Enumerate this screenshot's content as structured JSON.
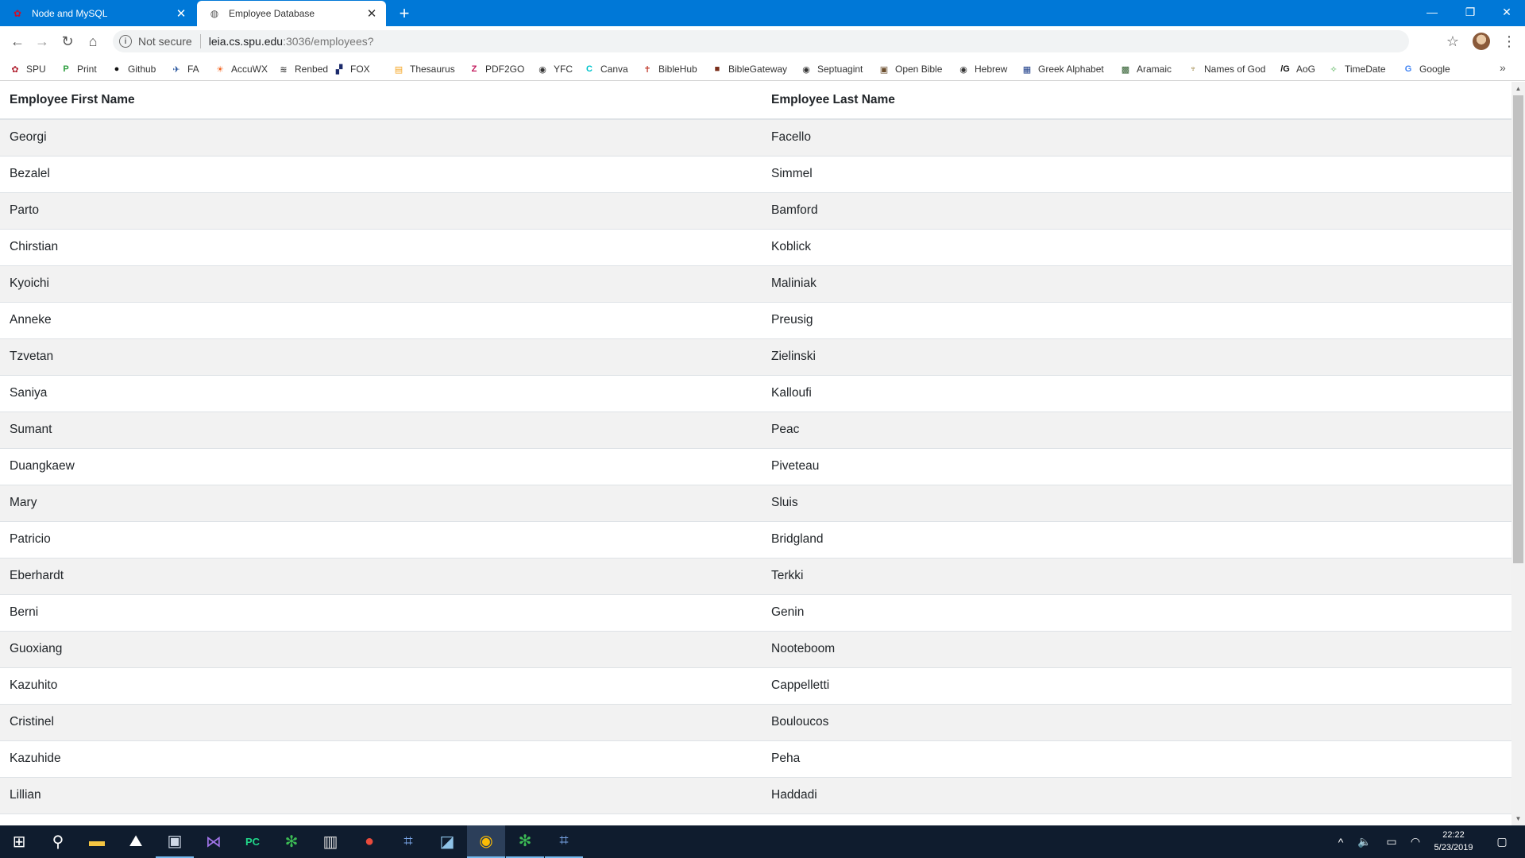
{
  "browser": {
    "tabs": [
      {
        "title": "Node and MySQL",
        "close": "✕",
        "active": false,
        "favicon": "spu-maple-leaf-icon"
      },
      {
        "title": "Employee Database",
        "close": "✕",
        "active": true,
        "favicon": "globe-icon"
      }
    ],
    "new_tab": "+",
    "window_controls": {
      "minimize": "—",
      "restore": "❐",
      "close": "✕"
    },
    "nav": {
      "back": "←",
      "forward": "→",
      "reload": "↻",
      "home": "⌂"
    },
    "address": {
      "security_icon": "i",
      "security_label": "Not secure",
      "host": "leia.cs.spu.edu",
      "path": ":3036/employees?"
    },
    "star": "☆",
    "menu": "⋮",
    "bookmarks": [
      {
        "label": "SPU",
        "icon": "✿",
        "color": "#b01e2d"
      },
      {
        "label": "Print",
        "icon": "P",
        "color": "#2a9d3c"
      },
      {
        "label": "Github",
        "icon": "●",
        "color": "#111111"
      },
      {
        "label": "FA",
        "icon": "✈",
        "color": "#1f4e99"
      },
      {
        "label": "AccuWX",
        "icon": "☀",
        "color": "#f26522"
      },
      {
        "label": "Renbed",
        "icon": "≋",
        "color": "#555555"
      },
      {
        "label": "FOX",
        "icon": "▞",
        "color": "#1b2a6b"
      },
      {
        "label": "Thesaurus",
        "icon": "▤",
        "color": "#f5a623"
      },
      {
        "label": "PDF2GO",
        "icon": "Z",
        "color": "#c2185b"
      },
      {
        "label": "YFC",
        "icon": "◉",
        "color": "#333333"
      },
      {
        "label": "Canva",
        "icon": "C",
        "color": "#00c4cc"
      },
      {
        "label": "BibleHub",
        "icon": "✝",
        "color": "#c0392b"
      },
      {
        "label": "BibleGateway",
        "icon": "■",
        "color": "#7a2e1a"
      },
      {
        "label": "Septuagint",
        "icon": "◉",
        "color": "#333333"
      },
      {
        "label": "Open Bible",
        "icon": "▣",
        "color": "#6b4e2e"
      },
      {
        "label": "Hebrew",
        "icon": "◉",
        "color": "#333333"
      },
      {
        "label": "Greek Alphabet",
        "icon": "▦",
        "color": "#1f3f8a"
      },
      {
        "label": "Aramaic",
        "icon": "▩",
        "color": "#2d5c2d"
      },
      {
        "label": "Names of God",
        "icon": "♆",
        "color": "#8a6d1f"
      },
      {
        "label": "AoG",
        "icon": "/G",
        "color": "#111111"
      },
      {
        "label": "TimeDate",
        "icon": "✧",
        "color": "#4caf50"
      },
      {
        "label": "Google",
        "icon": "G",
        "color": "#4285f4"
      }
    ],
    "bookmarks_more": "»"
  },
  "table": {
    "headers": [
      "Employee First Name",
      "Employee Last Name"
    ],
    "rows": [
      [
        "Georgi",
        "Facello"
      ],
      [
        "Bezalel",
        "Simmel"
      ],
      [
        "Parto",
        "Bamford"
      ],
      [
        "Chirstian",
        "Koblick"
      ],
      [
        "Kyoichi",
        "Maliniak"
      ],
      [
        "Anneke",
        "Preusig"
      ],
      [
        "Tzvetan",
        "Zielinski"
      ],
      [
        "Saniya",
        "Kalloufi"
      ],
      [
        "Sumant",
        "Peac"
      ],
      [
        "Duangkaew",
        "Piveteau"
      ],
      [
        "Mary",
        "Sluis"
      ],
      [
        "Patricio",
        "Bridgland"
      ],
      [
        "Eberhardt",
        "Terkki"
      ],
      [
        "Berni",
        "Genin"
      ],
      [
        "Guoxiang",
        "Nooteboom"
      ],
      [
        "Kazuhito",
        "Cappelletti"
      ],
      [
        "Cristinel",
        "Bouloucos"
      ],
      [
        "Kazuhide",
        "Peha"
      ],
      [
        "Lillian",
        "Haddadi"
      ],
      [
        "",
        ""
      ]
    ]
  },
  "scrollbar": {
    "up": "▲",
    "down": "▼"
  },
  "taskbar": {
    "apps": [
      {
        "name": "start-icon",
        "glyph": "⊞",
        "color": "#ffffff",
        "state": ""
      },
      {
        "name": "search-icon",
        "glyph": "⚲",
        "color": "#ffffff",
        "state": ""
      },
      {
        "name": "file-explorer-icon",
        "glyph": "▬",
        "color": "#f4c542",
        "state": ""
      },
      {
        "name": "app-icon",
        "glyph": "⛰",
        "color": "#ffffff",
        "state": ""
      },
      {
        "name": "app-icon",
        "glyph": "▣",
        "color": "#cfd8e6",
        "state": "running"
      },
      {
        "name": "visual-studio-icon",
        "glyph": "⋈",
        "color": "#a074e8",
        "state": ""
      },
      {
        "name": "pycharm-icon",
        "glyph": "PC",
        "color": "#21d789",
        "state": ""
      },
      {
        "name": "app-icon",
        "glyph": "✻",
        "color": "#3cba54",
        "state": ""
      },
      {
        "name": "app-icon",
        "glyph": "▥",
        "color": "#dddddd",
        "state": ""
      },
      {
        "name": "app-icon",
        "glyph": "●",
        "color": "#e94b3c",
        "state": ""
      },
      {
        "name": "app-icon",
        "glyph": "⌗",
        "color": "#7aa6e8",
        "state": ""
      },
      {
        "name": "app-icon",
        "glyph": "◪",
        "color": "#8fc3e8",
        "state": ""
      },
      {
        "name": "chrome-icon",
        "glyph": "◉",
        "color": "#fbbc05",
        "state": "active"
      },
      {
        "name": "app-icon",
        "glyph": "✻",
        "color": "#3cba54",
        "state": "running"
      },
      {
        "name": "app-icon",
        "glyph": "⌗",
        "color": "#7aa6e8",
        "state": "running"
      }
    ],
    "tray": {
      "chevron": "^",
      "volume": "🔈",
      "battery": "▭",
      "wifi": "◠",
      "notifications": "▢"
    },
    "time": "22:22",
    "date": "5/23/2019"
  }
}
